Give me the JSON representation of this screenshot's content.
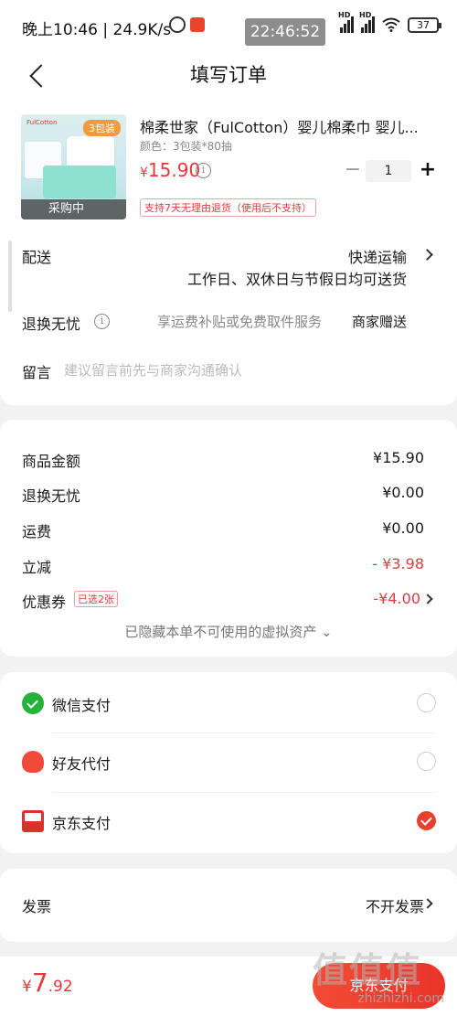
{
  "status_bar": {
    "left_text": "晚上10:46 | 24.9K/s",
    "time": "22:46:52",
    "signal_hd": "HD",
    "battery": "37"
  },
  "header": {
    "title": "填写订单"
  },
  "product": {
    "name": "棉柔世家（FulCotton）婴儿棉柔巾 婴儿...",
    "spec": "颜色：3包装*80抽",
    "currency": "¥",
    "price": "15.90",
    "quantity": "1",
    "badge": "3包装",
    "brand": "FulCotton",
    "status_overlay": "采购中",
    "return_tag": "支持7天无理由退货（使用后不支持）"
  },
  "shipping": {
    "label": "配送",
    "value": "快递运输",
    "sub": "工作日、双休日与节假日均可送货"
  },
  "worry_free": {
    "label": "退换无忧",
    "desc": "享运费补贴或免费取件服务",
    "value": "商家赠送"
  },
  "remark": {
    "label": "留言",
    "placeholder": "建议留言前先与商家沟通确认"
  },
  "fees": {
    "goods_label": "商品金额",
    "goods_val": "¥15.90",
    "worry_label": "退换无忧",
    "worry_val": "¥0.00",
    "freight_label": "运费",
    "freight_val": "¥0.00",
    "discount_label": "立减",
    "discount_val": "- ¥3.98",
    "coupon_label": "优惠券",
    "coupon_tag": "已选2张",
    "coupon_val": "-¥4.00",
    "hidden_note": "已隐藏本单不可使用的虚拟资产 ⌄"
  },
  "payment": {
    "methods": [
      {
        "label": "微信支付",
        "selected": false,
        "icon": "wechat-pay-icon"
      },
      {
        "label": "好友代付",
        "selected": false,
        "icon": "friend-pay-icon"
      },
      {
        "label": "京东支付",
        "selected": true,
        "icon": "jd-pay-icon"
      }
    ]
  },
  "invoice": {
    "label": "发票",
    "value": "不开发票"
  },
  "bottom": {
    "currency": "¥",
    "total_int": "7",
    "total_dec": ".92",
    "pay_button": "京东支付"
  },
  "watermark": {
    "text": "值值值",
    "url": "zhizhizhi.com"
  },
  "colors": {
    "accent": "#e4393c",
    "wechat": "#23b33a",
    "background": "#f2f2f2"
  }
}
